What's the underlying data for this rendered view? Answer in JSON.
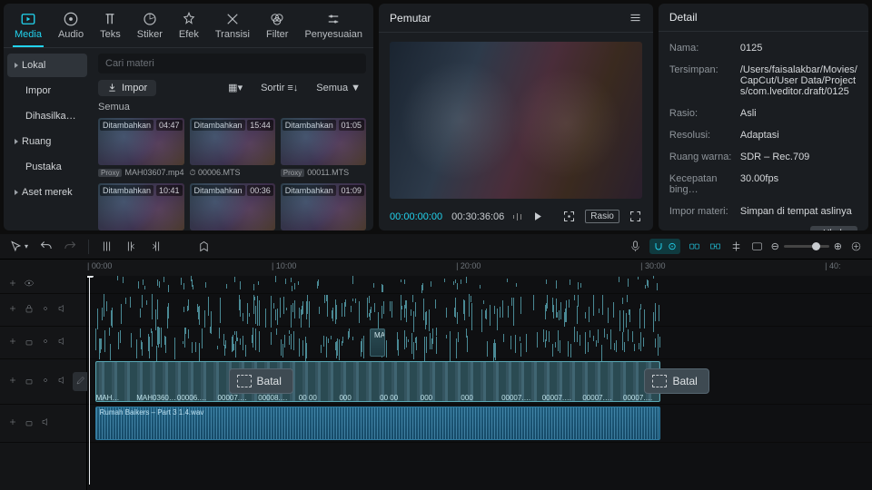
{
  "tabs": [
    {
      "label": "Media",
      "icon": "media"
    },
    {
      "label": "Audio",
      "icon": "audio"
    },
    {
      "label": "Teks",
      "icon": "text"
    },
    {
      "label": "Stiker",
      "icon": "sticker"
    },
    {
      "label": "Efek",
      "icon": "effect"
    },
    {
      "label": "Transisi",
      "icon": "transition"
    },
    {
      "label": "Filter",
      "icon": "filter"
    },
    {
      "label": "Penyesuaian",
      "icon": "adjust"
    }
  ],
  "sidebar": {
    "items": [
      {
        "label": "Lokal",
        "expandable": true,
        "active": true
      },
      {
        "label": "Impor"
      },
      {
        "label": "Dihasilkan …"
      },
      {
        "label": "Ruang",
        "expandable": true
      },
      {
        "label": "Pustaka"
      },
      {
        "label": "Aset merek",
        "expandable": true
      }
    ]
  },
  "library": {
    "search_placeholder": "Cari materi",
    "import_label": "Impor",
    "view_label": "▦▾",
    "sort_label": "Sortir",
    "filter_label": "Semua",
    "section": "Semua",
    "clips": [
      {
        "added": "Ditambahkan",
        "dur": "04:47",
        "proxy": "Proxy",
        "name": "MAH03607.mp4"
      },
      {
        "added": "Ditambahkan",
        "dur": "15:44",
        "icon": "clock",
        "name": "00006.MTS"
      },
      {
        "added": "Ditambahkan",
        "dur": "01:05",
        "proxy": "Proxy",
        "name": "00011.MTS"
      },
      {
        "added": "Ditambahkan",
        "dur": "10:41",
        "name": ""
      },
      {
        "added": "Ditambahkan",
        "dur": "00:36",
        "name": ""
      },
      {
        "added": "Ditambahkan",
        "dur": "01:09",
        "name": ""
      }
    ]
  },
  "player": {
    "title": "Pemutar",
    "current": "00:00:00:00",
    "total": "00:30:36:06",
    "ratio_label": "Rasio"
  },
  "detail": {
    "title": "Detail",
    "rows": [
      {
        "k": "Nama:",
        "v": "0125"
      },
      {
        "k": "Tersimpan:",
        "v": "/Users/faisalakbar/Movies/CapCut/User Data/Projects/com.lveditor.draft/0125"
      },
      {
        "k": "Rasio:",
        "v": "Asli"
      },
      {
        "k": "Resolusi:",
        "v": "Adaptasi"
      },
      {
        "k": "Ruang warna:",
        "v": "SDR – Rec.709"
      },
      {
        "k": "Kecepatan bing…",
        "v": "30.00fps"
      },
      {
        "k": "Impor materi:",
        "v": "Simpan di tempat aslinya"
      }
    ],
    "change_label": "Ubah"
  },
  "timeline": {
    "ruler": [
      "00:00",
      "10:00",
      "20:00",
      "30:00",
      "40:"
    ],
    "playhead_pct": 0.2,
    "batal_label": "Batal",
    "audio_clip_label": "Rumah Baikers –   Part 3 1.4.wav",
    "main_labels": [
      "MAH…",
      "MAH0360…",
      "00006.…",
      "00007.…",
      "00008.…",
      "00 00",
      "000",
      "00 00",
      "000",
      "000",
      "00007.…",
      "00007.…",
      "00007.…",
      "00007.…"
    ]
  }
}
